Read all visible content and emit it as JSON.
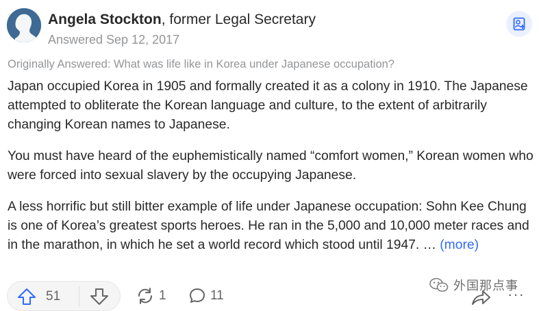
{
  "author": {
    "name": "Angela Stockton",
    "credential": ", former Legal Secretary",
    "answered": "Answered Sep 12, 2017"
  },
  "question": {
    "original": "Originally Answered: What was life like in Korea under Japanese occupation?"
  },
  "answer": {
    "paragraphs": [
      "Japan occupied Korea in 1905 and formally created it as a colony in 1910. The Japanese attempted to obliterate the Korean language and culture, to the extent of arbitrarily changing Korean names to Japanese.",
      "You must have heard of the euphemistically named “comfort women,” Korean women who were forced into sexual slavery by the occupying Japanese.",
      "A less horrific but still bitter example of life under Japanese occupation: Sohn Kee Chung is one of Korea’s greatest sports heroes. He ran in the 5,000 and 10,000 meter races and in the marathon, in which he set a world record which stood until 1947. … "
    ],
    "more_label": "(more)"
  },
  "actions": {
    "upvotes": "51",
    "shares": "1",
    "comments": "11",
    "more": "···"
  },
  "watermark": {
    "text": "外国那点事"
  },
  "icons": {
    "follow": "person-plus-icon",
    "upvote": "arrow-up-icon",
    "downvote": "arrow-down-icon",
    "share": "reshare-icon",
    "comment": "comment-bubble-icon",
    "forward": "forward-arrow-icon",
    "watermark": "wechat-logo-icon"
  },
  "colors": {
    "accent": "#2e69ff",
    "text": "#282829",
    "muted": "#939598",
    "follow_bg": "#ebf0ff"
  }
}
